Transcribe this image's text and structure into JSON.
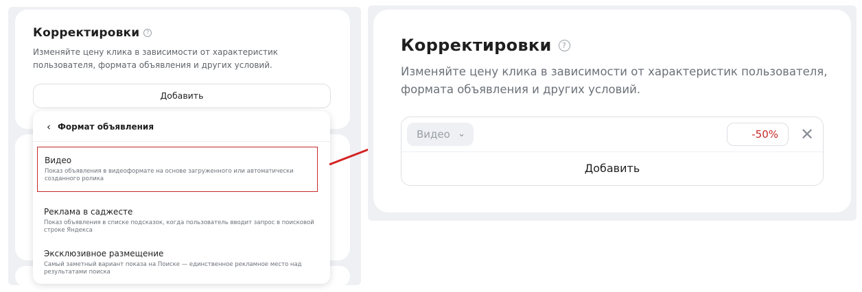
{
  "left": {
    "title": "Корректировки",
    "help_icon": "?",
    "description": "Изменяйте цену клика в зависимости от характеристик пользователя, формата объявления и других условий.",
    "add_button": "Добавить",
    "dropdown": {
      "back_icon": "‹",
      "header": "Формат объявления",
      "options": [
        {
          "name": "Видео",
          "desc": "Показ объявления в видеоформате на основе загруженного или автоматически созданного ролика"
        },
        {
          "name": "Реклама в саджесте",
          "desc": "Показ объявления в списке подсказок, когда пользователь вводит запрос в поисковой строке Яндекса"
        },
        {
          "name": "Эксклюзивное размещение",
          "desc": "Самый заметный вариант показа на Поиске — единственное рекламное место над результатами поиска"
        }
      ]
    }
  },
  "right": {
    "title": "Корректировки",
    "help_icon": "?",
    "description": "Изменяйте цену клика в зависимости от характеристик пользователя, формата объявления и других условий.",
    "selected_value": "Видео",
    "chevron_icon": "⌄",
    "percent_value": "-50%",
    "close_icon": "✕",
    "add_button": "Добавить"
  },
  "colors": {
    "highlight": "#c62828",
    "arrow": "#d32222",
    "negative_value": "#c62828"
  }
}
